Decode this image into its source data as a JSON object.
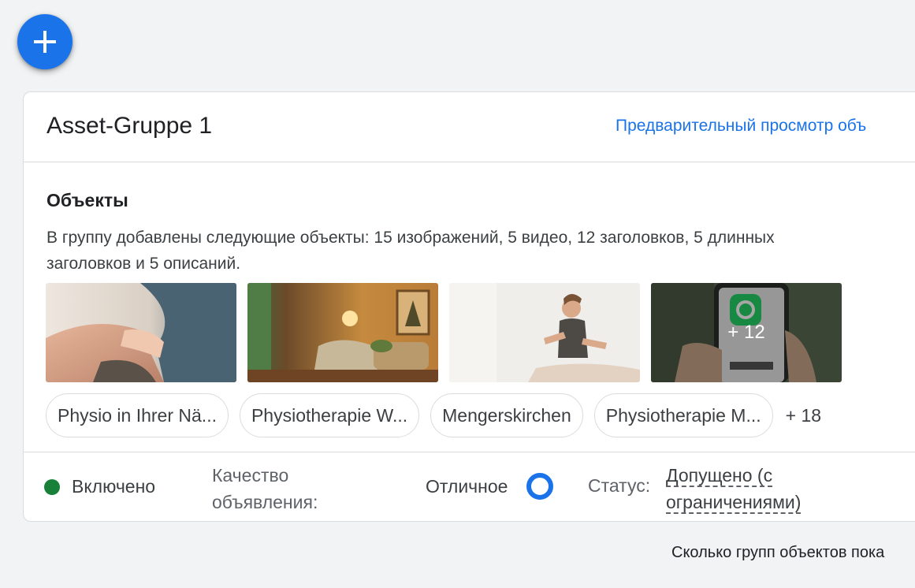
{
  "fab": {
    "icon": "plus-icon",
    "color": "#1a73e8"
  },
  "asset_group": {
    "title": "Asset-Gruppe 1",
    "preview_link": "Предварительный просмотр объ"
  },
  "objects": {
    "heading": "Объекты",
    "description": "В группу добавлены следующие объекты: 15 изображений, 5 видео, 12 заголовков, 5 длинных заголовков и 5 описаний.",
    "more_images_label": "+ 12",
    "headlines": [
      "Physio in Ihrer Nä...",
      "Physiotherapie W...",
      "Mengerskirchen",
      "Physiotherapie M..."
    ],
    "more_headlines_label": "+ 18"
  },
  "footer": {
    "enabled_label": "Включено",
    "enabled_color": "#188038",
    "quality_label": "Качество объявления:",
    "quality_value": "Отличное",
    "status_label": "Статус:",
    "status_value": "Допущено (с ограничениями)"
  },
  "bottom_text": "Сколько групп объектов пока"
}
